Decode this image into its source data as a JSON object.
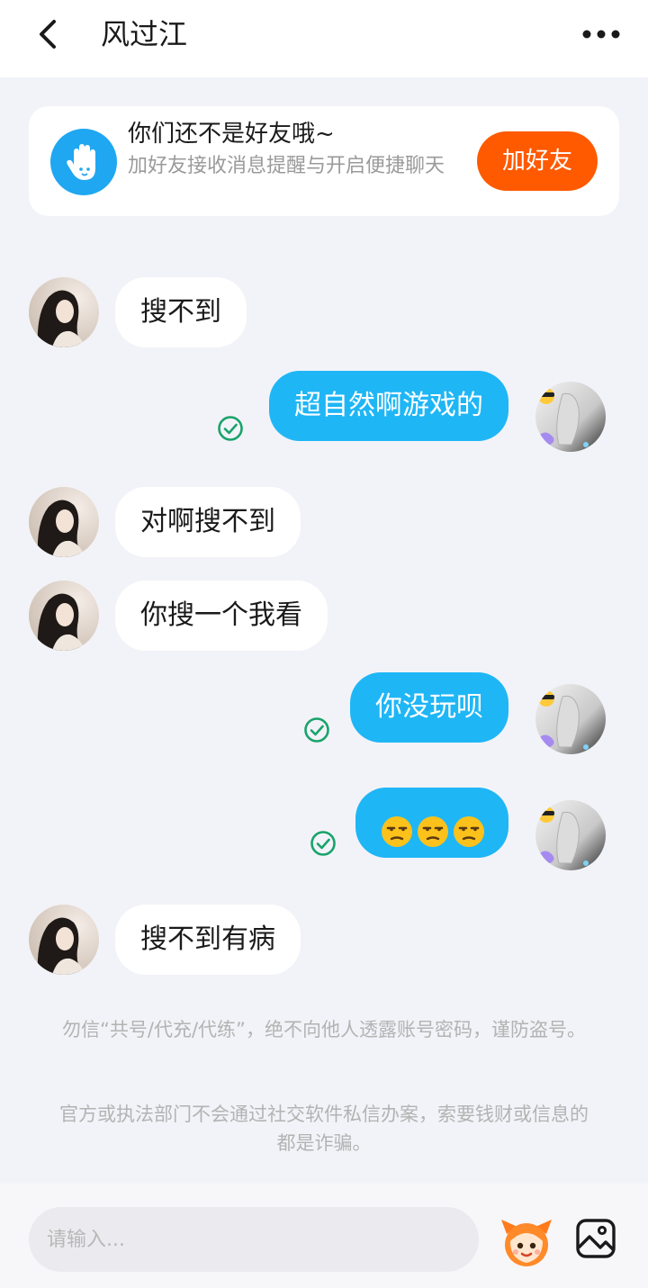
{
  "header": {
    "title": "风过江",
    "back_icon": "chevron-left-icon",
    "more_icon": "more-dots-icon"
  },
  "friend_prompt": {
    "title": "你们还不是好友哦~",
    "description": "加好友接收消息提醒与开启便捷聊天",
    "button_label": "加好友",
    "icon": "hand-icon",
    "accent_color": "#ff5a00"
  },
  "messages": [
    {
      "sender": "them",
      "text": "搜不到"
    },
    {
      "sender": "me",
      "text": "超自然啊游戏的",
      "status": "read"
    },
    {
      "sender": "them",
      "text": "对啊搜不到"
    },
    {
      "sender": "them",
      "text": "你搜一个我看"
    },
    {
      "sender": "me",
      "text": "你没玩呗",
      "status": "read"
    },
    {
      "sender": "me",
      "text": "😒😒😒",
      "status": "read"
    },
    {
      "sender": "them",
      "text": "搜不到有病"
    }
  ],
  "notices": {
    "notice_1": "勿信“共号/代充/代练”，绝不向他人透露账号密码，谨防盗号。",
    "notice_2": "官方或执法部门不会通过社交软件私信办案，索要钱财或信息的都是诈骗。"
  },
  "composer": {
    "placeholder": "请输入...",
    "mascot_icon": "mascot-emoji-icon",
    "image_icon": "image-icon"
  },
  "colors": {
    "my_bubble": "#1fb6f6",
    "their_bubble": "#ffffff",
    "read_check": "#1aa36b",
    "background": "#f2f3f8"
  }
}
